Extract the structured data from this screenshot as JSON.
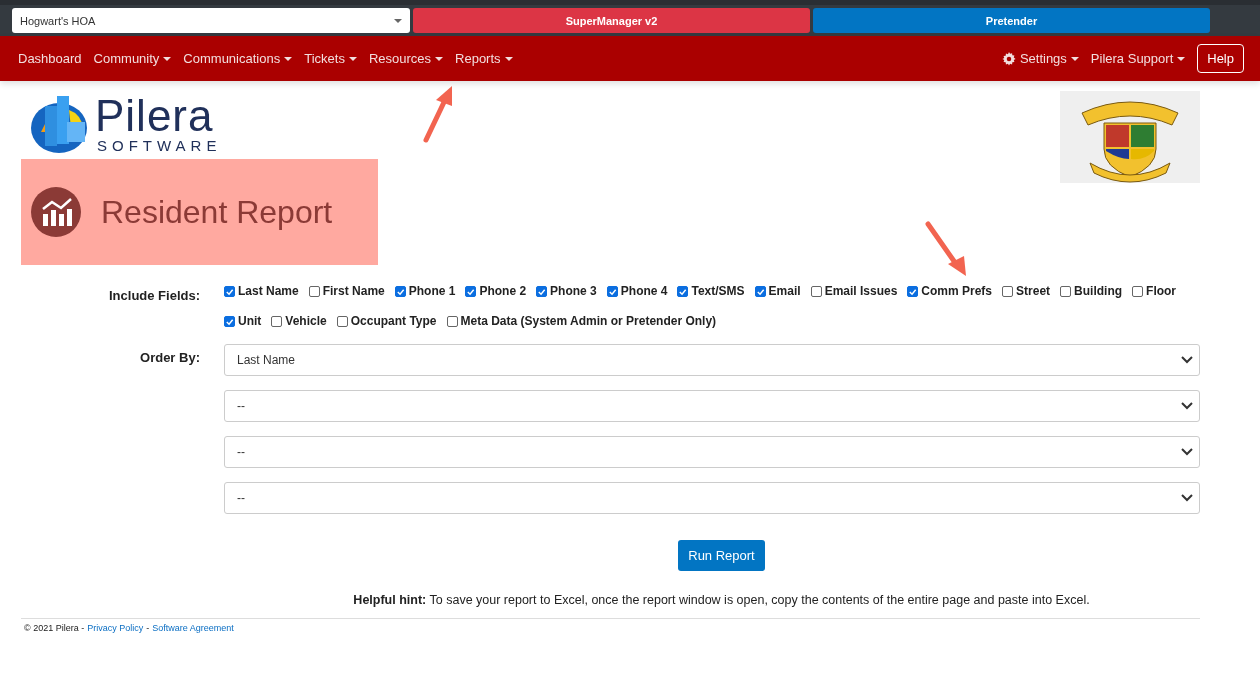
{
  "top_bar": {
    "community_select": {
      "value": "Hogwart's HOA"
    },
    "buttons": [
      {
        "label": "SuperManager v2",
        "kind": "danger"
      },
      {
        "label": "Pretender",
        "kind": "primary"
      }
    ]
  },
  "nav": {
    "items": [
      {
        "label": "Dashboard",
        "dropdown": false
      },
      {
        "label": "Community",
        "dropdown": true
      },
      {
        "label": "Communications",
        "dropdown": true
      },
      {
        "label": "Tickets",
        "dropdown": true
      },
      {
        "label": "Resources",
        "dropdown": true
      },
      {
        "label": "Reports",
        "dropdown": true
      }
    ],
    "right_items": [
      {
        "label": "Settings",
        "dropdown": true,
        "kind": "icon"
      },
      {
        "label": "Pilera Support",
        "dropdown": true,
        "kind": "plain"
      }
    ],
    "help_button": "Help"
  },
  "logo": {
    "name": "Pilera",
    "tagline": "SOFTWARE"
  },
  "page_title": "Resident Report",
  "form": {
    "include_label": "Include Fields:",
    "fields": [
      {
        "label": "Last Name",
        "checked": true
      },
      {
        "label": "First Name",
        "checked": false
      },
      {
        "label": "Phone 1",
        "checked": true
      },
      {
        "label": "Phone 2",
        "checked": true
      },
      {
        "label": "Phone 3",
        "checked": true
      },
      {
        "label": "Phone 4",
        "checked": true
      },
      {
        "label": "Text/SMS",
        "checked": true
      },
      {
        "label": "Email",
        "checked": true
      },
      {
        "label": "Email Issues",
        "checked": false
      },
      {
        "label": "Comm Prefs",
        "checked": true
      },
      {
        "label": "Street",
        "checked": false
      },
      {
        "label": "Building",
        "checked": false
      },
      {
        "label": "Floor",
        "checked": false
      },
      {
        "label": "Unit",
        "checked": true
      },
      {
        "label": "Vehicle",
        "checked": false
      },
      {
        "label": "Occupant Type",
        "checked": false
      },
      {
        "label": "Meta Data (System Admin or Pretender Only)",
        "checked": false
      }
    ],
    "order_label": "Order By:",
    "order_selects": [
      {
        "value": "Last Name"
      },
      {
        "value": "--"
      },
      {
        "value": "--"
      },
      {
        "value": "--"
      }
    ],
    "run_button": "Run Report",
    "hint": "**Helpful hint:** To save your report to Excel, once the report window is open, copy the contents of the entire page and paste into Excel."
  },
  "footer": {
    "copyright": "© 2021 Pilera -",
    "links": [
      "Privacy Policy",
      "Software Agreement"
    ],
    "separator": "-"
  }
}
